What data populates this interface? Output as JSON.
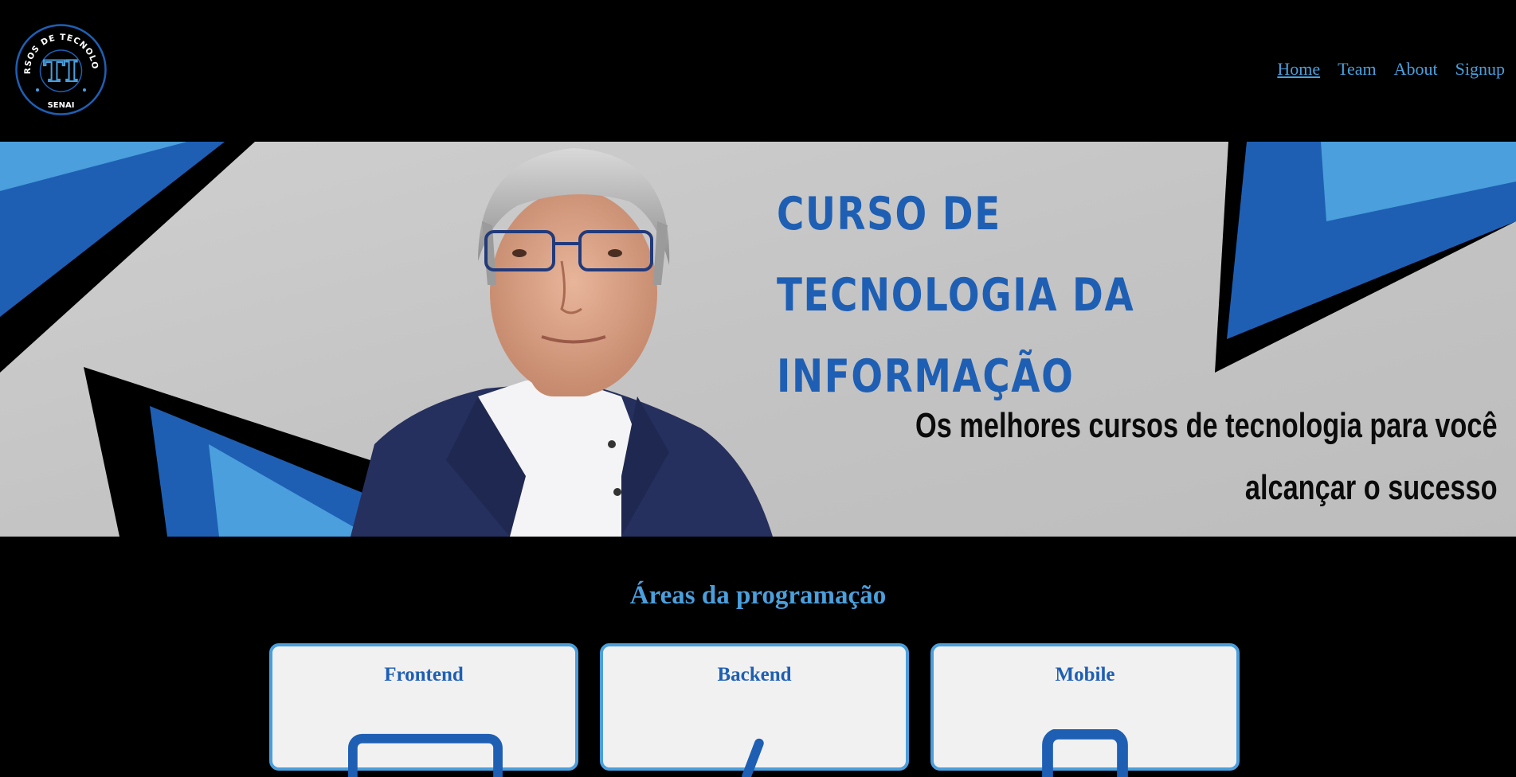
{
  "header": {
    "logo_text_top": "CURSOS DE TECNOLOGIA",
    "logo_text_bottom": "SENAI",
    "logo_monogram": "TI",
    "nav": [
      {
        "label": "Home",
        "active": true
      },
      {
        "label": "Team",
        "active": false
      },
      {
        "label": "About",
        "active": false
      },
      {
        "label": "Signup",
        "active": false
      }
    ]
  },
  "hero": {
    "title_lines": [
      "CURSO DE",
      "TECNOLOGIA DA",
      "INFORMAÇÃO"
    ],
    "subtitle_lines": [
      "Os melhores cursos de tecnologia para você",
      "alcançar o sucesso"
    ]
  },
  "areas": {
    "title": "Áreas da programação",
    "cards": [
      {
        "title": "Frontend",
        "icon": "monitor-icon"
      },
      {
        "title": "Backend",
        "icon": "code-slash-icon"
      },
      {
        "title": "Mobile",
        "icon": "smartphone-icon"
      }
    ]
  },
  "colors": {
    "background": "#000000",
    "accent_light": "#4a9fdc",
    "accent_dark": "#1e5fb4",
    "card_bg": "#f1f1f1"
  }
}
